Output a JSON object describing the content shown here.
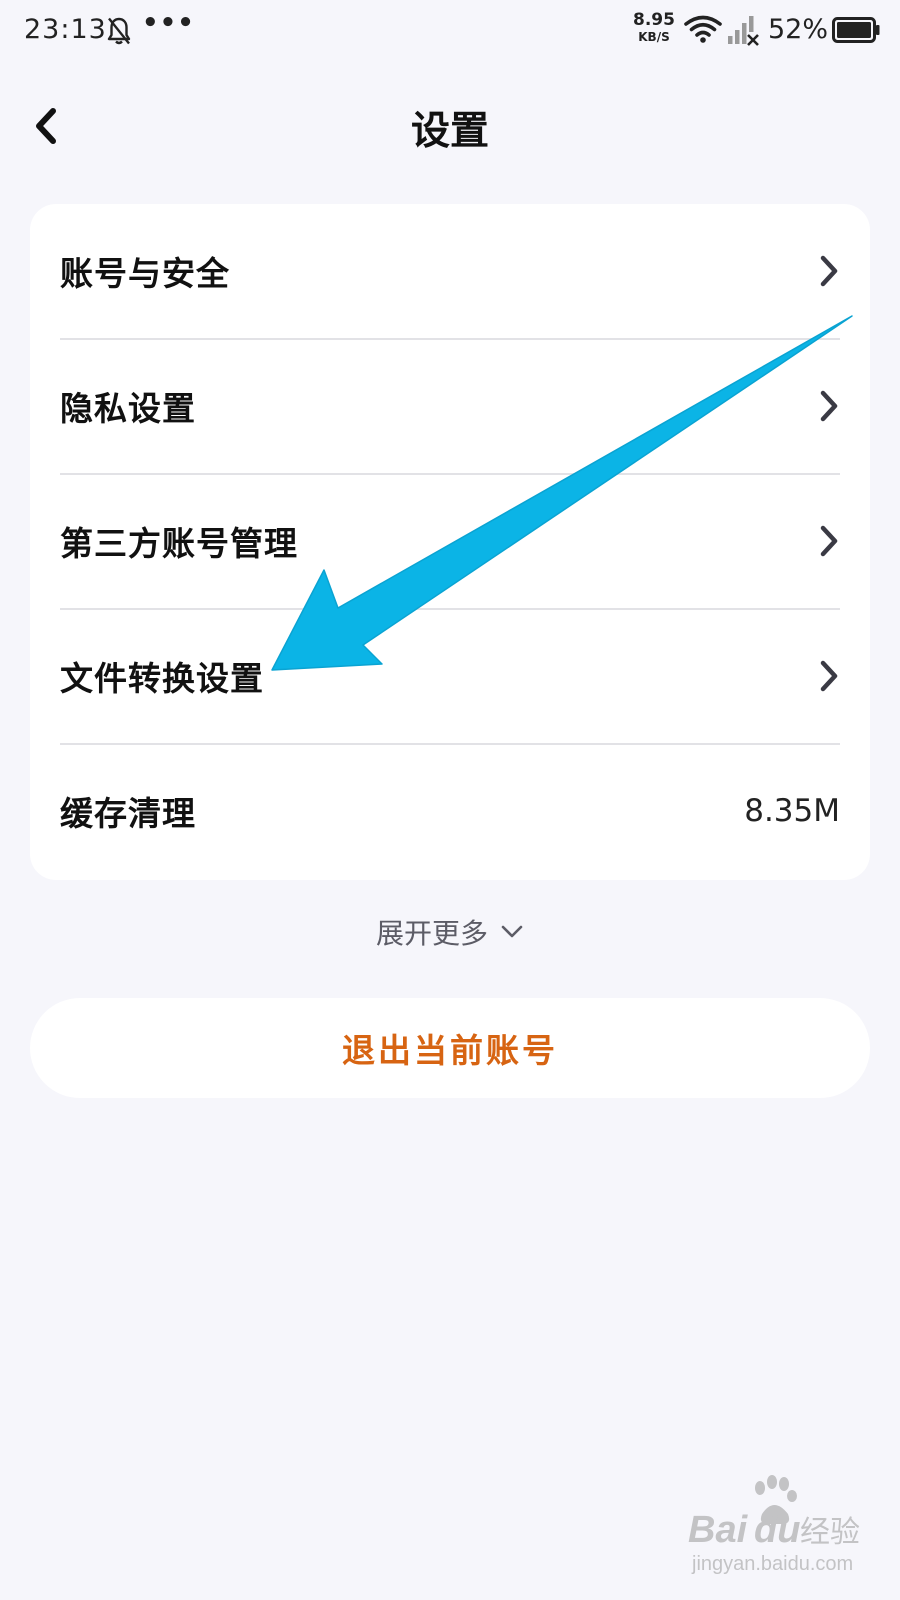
{
  "status_bar": {
    "time": "23:13",
    "dots": "•••",
    "net_speed_value": "8.95",
    "net_speed_unit": "KB/S",
    "battery": "52%"
  },
  "header": {
    "title": "设置",
    "back_icon": "chevron-left-icon"
  },
  "settings": {
    "items": [
      {
        "label": "账号与安全",
        "icon": "chevron-right-icon"
      },
      {
        "label": "隐私设置",
        "icon": "chevron-right-icon"
      },
      {
        "label": "第三方账号管理",
        "icon": "chevron-right-icon"
      },
      {
        "label": "文件转换设置",
        "icon": "chevron-right-icon"
      },
      {
        "label": "缓存清理",
        "value": "8.35M"
      }
    ]
  },
  "expand_more": {
    "label": "展开更多",
    "icon": "chevron-down-icon"
  },
  "logout": {
    "label": "退出当前账号",
    "color": "#d76412"
  },
  "annotation": {
    "arrow_color": "#0bb4e6"
  },
  "watermark": {
    "brand": "Baidu经验",
    "url": "jingyan.baidu.com"
  },
  "colors": {
    "background": "#f6f6fb",
    "card": "#ffffff",
    "divider": "#e2e2e6",
    "secondary_text": "#5c5c66"
  }
}
